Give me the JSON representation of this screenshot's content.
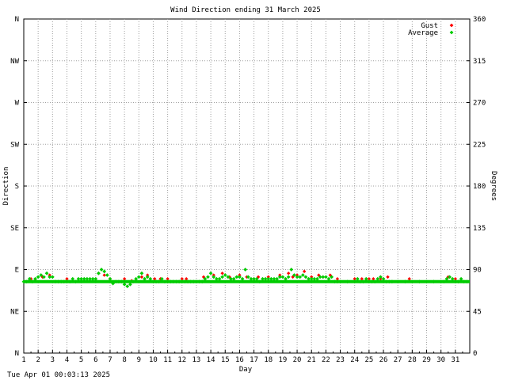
{
  "chart_data": {
    "type": "scatter",
    "title": "Wind Direction ending 31 March 2025",
    "xlabel": "Day",
    "ylabel_left": "Direction",
    "ylabel_right": "Degrees",
    "x_ticks": [
      1,
      2,
      3,
      4,
      5,
      6,
      7,
      8,
      9,
      10,
      11,
      12,
      13,
      14,
      15,
      16,
      17,
      18,
      19,
      20,
      21,
      22,
      23,
      24,
      25,
      26,
      27,
      28,
      29,
      30,
      31
    ],
    "xlim": [
      1,
      32
    ],
    "ylim": [
      0,
      360
    ],
    "y_ticks_left": [
      {
        "value": 0,
        "label": "N"
      },
      {
        "value": 45,
        "label": "NE"
      },
      {
        "value": 90,
        "label": "E"
      },
      {
        "value": 135,
        "label": "SE"
      },
      {
        "value": 180,
        "label": "S"
      },
      {
        "value": 225,
        "label": "SW"
      },
      {
        "value": 270,
        "label": "W"
      },
      {
        "value": 315,
        "label": "NW"
      },
      {
        "value": 360,
        "label": "N"
      }
    ],
    "y_ticks_right": [
      0,
      45,
      90,
      135,
      180,
      225,
      270,
      315,
      360
    ],
    "grid": true,
    "legend_position": "top-right",
    "series": [
      {
        "name": "Gust",
        "color": "#ff0000",
        "points": [
          [
            1.5,
            80
          ],
          [
            1.8,
            78
          ],
          [
            2.3,
            82
          ],
          [
            2.8,
            84
          ],
          [
            4.0,
            80
          ],
          [
            6.2,
            86
          ],
          [
            6.6,
            84
          ],
          [
            7.0,
            80
          ],
          [
            8.0,
            80
          ],
          [
            8.5,
            78
          ],
          [
            9.2,
            82
          ],
          [
            9.6,
            84
          ],
          [
            10.1,
            80
          ],
          [
            10.5,
            80
          ],
          [
            11.0,
            80
          ],
          [
            12.0,
            80
          ],
          [
            12.3,
            80
          ],
          [
            13.5,
            82
          ],
          [
            14.2,
            84
          ],
          [
            14.8,
            86
          ],
          [
            15.3,
            82
          ],
          [
            16.0,
            84
          ],
          [
            16.5,
            82
          ],
          [
            17.3,
            82
          ],
          [
            18.0,
            82
          ],
          [
            18.8,
            84
          ],
          [
            19.4,
            86
          ],
          [
            19.7,
            82
          ],
          [
            20.0,
            84
          ],
          [
            20.5,
            88
          ],
          [
            21.0,
            82
          ],
          [
            21.5,
            84
          ],
          [
            21.8,
            82
          ],
          [
            22.3,
            84
          ],
          [
            22.8,
            80
          ],
          [
            24.0,
            80
          ],
          [
            24.5,
            80
          ],
          [
            24.8,
            78
          ],
          [
            25.0,
            80
          ],
          [
            25.3,
            80
          ],
          [
            25.8,
            80
          ],
          [
            26.3,
            82
          ],
          [
            27.8,
            80
          ],
          [
            30.5,
            82
          ],
          [
            31.0,
            80
          ]
        ]
      },
      {
        "name": "Average",
        "color": "#00cc00",
        "points": [
          [
            1.0,
            77
          ],
          [
            1.2,
            77
          ],
          [
            1.4,
            80
          ],
          [
            1.6,
            77
          ],
          [
            1.8,
            80
          ],
          [
            2.0,
            82
          ],
          [
            2.2,
            84
          ],
          [
            2.4,
            82
          ],
          [
            2.6,
            86
          ],
          [
            2.8,
            82
          ],
          [
            3.0,
            82
          ],
          [
            3.2,
            77
          ],
          [
            3.4,
            77
          ],
          [
            3.6,
            77
          ],
          [
            3.8,
            77
          ],
          [
            4.0,
            77
          ],
          [
            4.2,
            77
          ],
          [
            4.4,
            80
          ],
          [
            4.6,
            77
          ],
          [
            4.8,
            80
          ],
          [
            5.0,
            80
          ],
          [
            5.2,
            80
          ],
          [
            5.4,
            80
          ],
          [
            5.6,
            80
          ],
          [
            5.8,
            80
          ],
          [
            6.0,
            80
          ],
          [
            6.2,
            86
          ],
          [
            6.4,
            90
          ],
          [
            6.6,
            88
          ],
          [
            6.8,
            84
          ],
          [
            7.0,
            80
          ],
          [
            7.2,
            75
          ],
          [
            7.4,
            77
          ],
          [
            7.6,
            77
          ],
          [
            7.8,
            77
          ],
          [
            8.0,
            74
          ],
          [
            8.2,
            72
          ],
          [
            8.4,
            74
          ],
          [
            8.6,
            77
          ],
          [
            8.8,
            80
          ],
          [
            9.0,
            82
          ],
          [
            9.2,
            86
          ],
          [
            9.4,
            80
          ],
          [
            9.6,
            82
          ],
          [
            9.8,
            80
          ],
          [
            10.0,
            77
          ],
          [
            10.2,
            77
          ],
          [
            10.4,
            77
          ],
          [
            10.6,
            80
          ],
          [
            10.8,
            77
          ],
          [
            11.0,
            77
          ],
          [
            11.2,
            77
          ],
          [
            11.4,
            77
          ],
          [
            11.6,
            77
          ],
          [
            11.8,
            77
          ],
          [
            12.0,
            77
          ],
          [
            12.2,
            77
          ],
          [
            12.4,
            77
          ],
          [
            12.6,
            77
          ],
          [
            12.8,
            77
          ],
          [
            13.0,
            77
          ],
          [
            13.2,
            77
          ],
          [
            13.4,
            77
          ],
          [
            13.6,
            80
          ],
          [
            13.8,
            82
          ],
          [
            14.0,
            86
          ],
          [
            14.2,
            82
          ],
          [
            14.4,
            80
          ],
          [
            14.6,
            80
          ],
          [
            14.8,
            82
          ],
          [
            15.0,
            84
          ],
          [
            15.2,
            82
          ],
          [
            15.4,
            80
          ],
          [
            15.6,
            80
          ],
          [
            15.8,
            82
          ],
          [
            16.0,
            82
          ],
          [
            16.2,
            80
          ],
          [
            16.4,
            90
          ],
          [
            16.6,
            82
          ],
          [
            16.8,
            80
          ],
          [
            17.0,
            80
          ],
          [
            17.2,
            80
          ],
          [
            17.4,
            77
          ],
          [
            17.6,
            80
          ],
          [
            17.8,
            80
          ],
          [
            18.0,
            80
          ],
          [
            18.2,
            80
          ],
          [
            18.4,
            80
          ],
          [
            18.6,
            80
          ],
          [
            18.8,
            82
          ],
          [
            19.0,
            82
          ],
          [
            19.2,
            80
          ],
          [
            19.4,
            82
          ],
          [
            19.6,
            90
          ],
          [
            19.8,
            84
          ],
          [
            20.0,
            82
          ],
          [
            20.2,
            82
          ],
          [
            20.4,
            84
          ],
          [
            20.6,
            82
          ],
          [
            20.8,
            80
          ],
          [
            21.0,
            80
          ],
          [
            21.2,
            80
          ],
          [
            21.4,
            80
          ],
          [
            21.6,
            82
          ],
          [
            21.8,
            82
          ],
          [
            22.0,
            82
          ],
          [
            22.2,
            80
          ],
          [
            22.4,
            82
          ],
          [
            22.6,
            77
          ],
          [
            22.8,
            77
          ],
          [
            23.0,
            77
          ],
          [
            23.5,
            77
          ],
          [
            24.0,
            77
          ],
          [
            24.2,
            80
          ],
          [
            24.4,
            77
          ],
          [
            24.6,
            77
          ],
          [
            24.8,
            80
          ],
          [
            25.0,
            77
          ],
          [
            25.2,
            77
          ],
          [
            25.4,
            77
          ],
          [
            25.6,
            80
          ],
          [
            25.8,
            82
          ],
          [
            26.0,
            80
          ],
          [
            26.2,
            77
          ],
          [
            26.4,
            77
          ],
          [
            26.6,
            77
          ],
          [
            27.0,
            77
          ],
          [
            27.5,
            77
          ],
          [
            28.0,
            77
          ],
          [
            28.5,
            77
          ],
          [
            29.0,
            77
          ],
          [
            29.5,
            77
          ],
          [
            30.0,
            77
          ],
          [
            30.2,
            77
          ],
          [
            30.4,
            80
          ],
          [
            30.6,
            82
          ],
          [
            30.8,
            80
          ],
          [
            31.0,
            77
          ],
          [
            31.2,
            77
          ],
          [
            31.4,
            80
          ],
          [
            31.6,
            77
          ],
          [
            31.8,
            77
          ]
        ]
      }
    ],
    "baseline_runs": [
      {
        "series": "Average",
        "value": 77,
        "from": 1.0,
        "to": 32.0
      }
    ]
  },
  "footer": {
    "timestamp": "Tue Apr 01 00:03:13 2025"
  }
}
